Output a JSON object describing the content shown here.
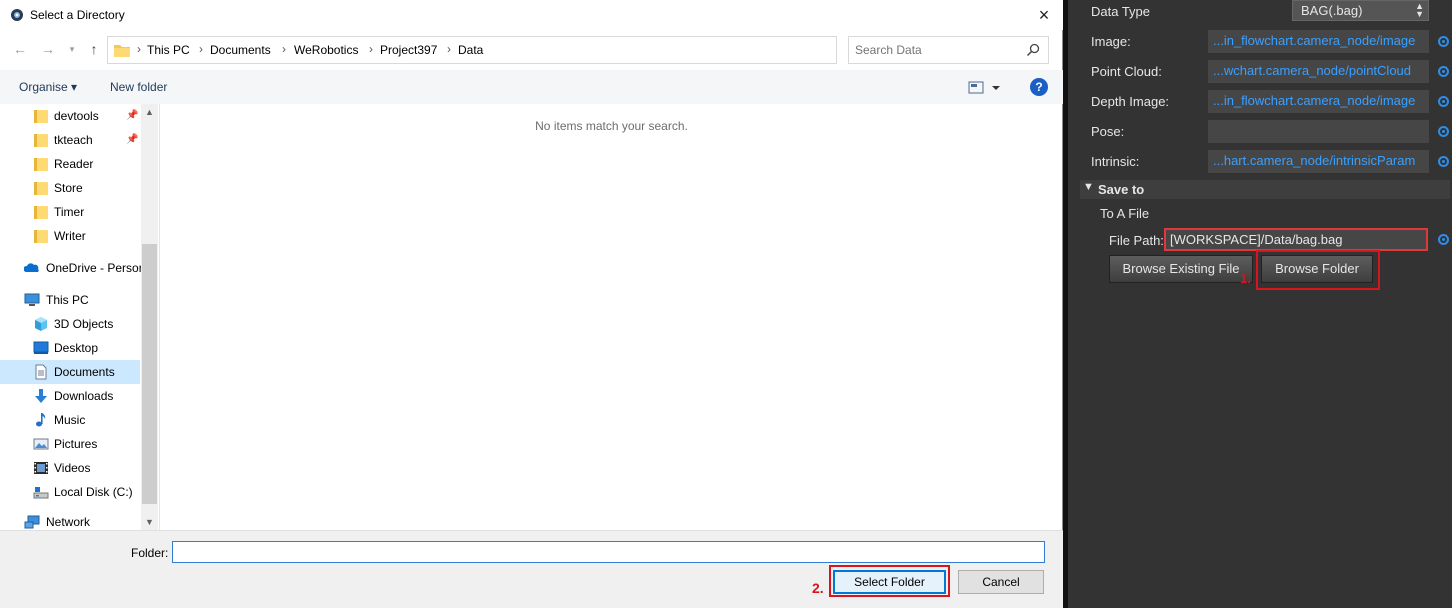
{
  "dialog": {
    "title": "Select a Directory",
    "close_icon": "×",
    "breadcrumb": [
      "This PC",
      "Documents",
      "WeRobotics",
      "Project397",
      "Data"
    ],
    "search_placeholder": "Search Data",
    "toolbar": {
      "organise": "Organise ▾",
      "new_folder": "New folder",
      "help": "?"
    },
    "nav_items": [
      {
        "label": "devtools",
        "icon": "folder-icon",
        "pinned": true
      },
      {
        "label": "tkteach",
        "icon": "folder-icon",
        "pinned": true
      },
      {
        "label": "Reader",
        "icon": "folder-icon",
        "pinned": false
      },
      {
        "label": "Store",
        "icon": "folder-icon",
        "pinned": false
      },
      {
        "label": "Timer",
        "icon": "folder-icon",
        "pinned": false
      },
      {
        "label": "Writer",
        "icon": "folder-icon",
        "pinned": false
      },
      {
        "label": "OneDrive - Persor",
        "icon": "onedrive-icon",
        "pinned": false
      },
      {
        "label": "This PC",
        "icon": "pc-icon",
        "pinned": false
      },
      {
        "label": "3D Objects",
        "icon": "cube-icon",
        "pinned": false
      },
      {
        "label": "Desktop",
        "icon": "desktop-icon",
        "pinned": false
      },
      {
        "label": "Documents",
        "icon": "document-icon",
        "pinned": false,
        "selected": true
      },
      {
        "label": "Downloads",
        "icon": "download-icon",
        "pinned": false
      },
      {
        "label": "Music",
        "icon": "music-icon",
        "pinned": false
      },
      {
        "label": "Pictures",
        "icon": "pictures-icon",
        "pinned": false
      },
      {
        "label": "Videos",
        "icon": "video-icon",
        "pinned": false
      },
      {
        "label": "Local Disk (C:)",
        "icon": "disk-icon",
        "pinned": false
      },
      {
        "label": "Network",
        "icon": "network-icon",
        "pinned": false
      }
    ],
    "empty_message": "No items match your search.",
    "folder_label": "Folder:",
    "folder_value": "",
    "select_button": "Select Folder",
    "cancel_button": "Cancel",
    "step_marker": "2."
  },
  "panel": {
    "data_type_label": "Data Type",
    "data_type_value": "BAG(.bag)",
    "rows": [
      {
        "label": "Image:",
        "value": "...in_flowchart.camera_node/image"
      },
      {
        "label": "Point Cloud:",
        "value": "...wchart.camera_node/pointCloud"
      },
      {
        "label": "Depth Image:",
        "value": "...in_flowchart.camera_node/image"
      },
      {
        "label": "Pose:",
        "value": ""
      },
      {
        "label": "Intrinsic:",
        "value": "...hart.camera_node/intrinsicParam"
      }
    ],
    "save_to": "Save to",
    "to_a_file": "To A File",
    "file_path_label": "File Path:",
    "file_path_value": "[WORKSPACE]/Data/bag.bag",
    "browse_file_button": "Browse Existing File",
    "browse_folder_button": "Browse Folder",
    "step_marker": "1."
  },
  "colors": {
    "accent": "#0078d7",
    "highlight_red": "#d9141e",
    "link_blue": "#3aa0ff",
    "panel_bg": "#333333"
  }
}
